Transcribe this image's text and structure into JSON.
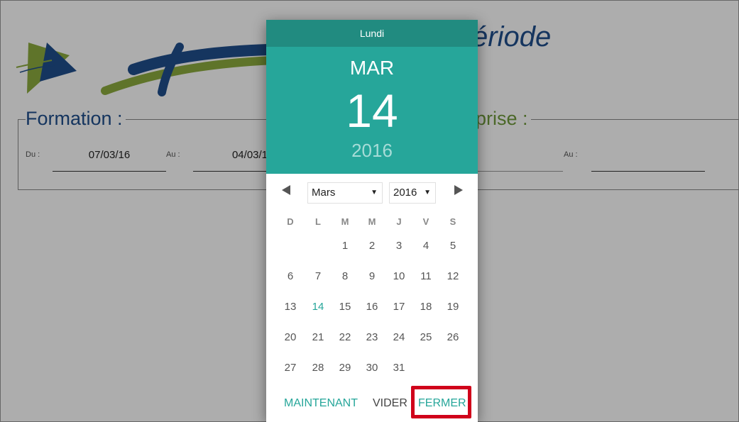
{
  "header": {
    "title_fragment": "ériode"
  },
  "formation": {
    "legend": "Formation :",
    "du_label": "Du :",
    "du_value": "07/03/16",
    "au_label": "Au :",
    "au_value": "04/03/1"
  },
  "entreprise": {
    "legend": "prise :",
    "au_label": "Au :"
  },
  "datepicker": {
    "weekday": "Lundi",
    "month_short": "MAR",
    "day": "14",
    "year": "2016",
    "month_select": "Mars",
    "year_select": "2016",
    "days_of_week": [
      "D",
      "L",
      "M",
      "M",
      "J",
      "V",
      "S"
    ],
    "weeks": [
      [
        "",
        "",
        "1",
        "2",
        "3",
        "4",
        "5"
      ],
      [
        "6",
        "7",
        "8",
        "9",
        "10",
        "11",
        "12"
      ],
      [
        "13",
        "14",
        "15",
        "16",
        "17",
        "18",
        "19"
      ],
      [
        "20",
        "21",
        "22",
        "23",
        "24",
        "25",
        "26"
      ],
      [
        "27",
        "28",
        "29",
        "30",
        "31",
        "",
        ""
      ]
    ],
    "selected_day": "14",
    "buttons": {
      "now": "MAINTENANT",
      "clear": "VIDER",
      "close": "FERMER"
    }
  },
  "colors": {
    "accent": "#26a69a",
    "accent_dark": "#218b80",
    "highlight": "#d0021b",
    "title_blue": "#1f4e8c",
    "green": "#6f9a3b"
  }
}
